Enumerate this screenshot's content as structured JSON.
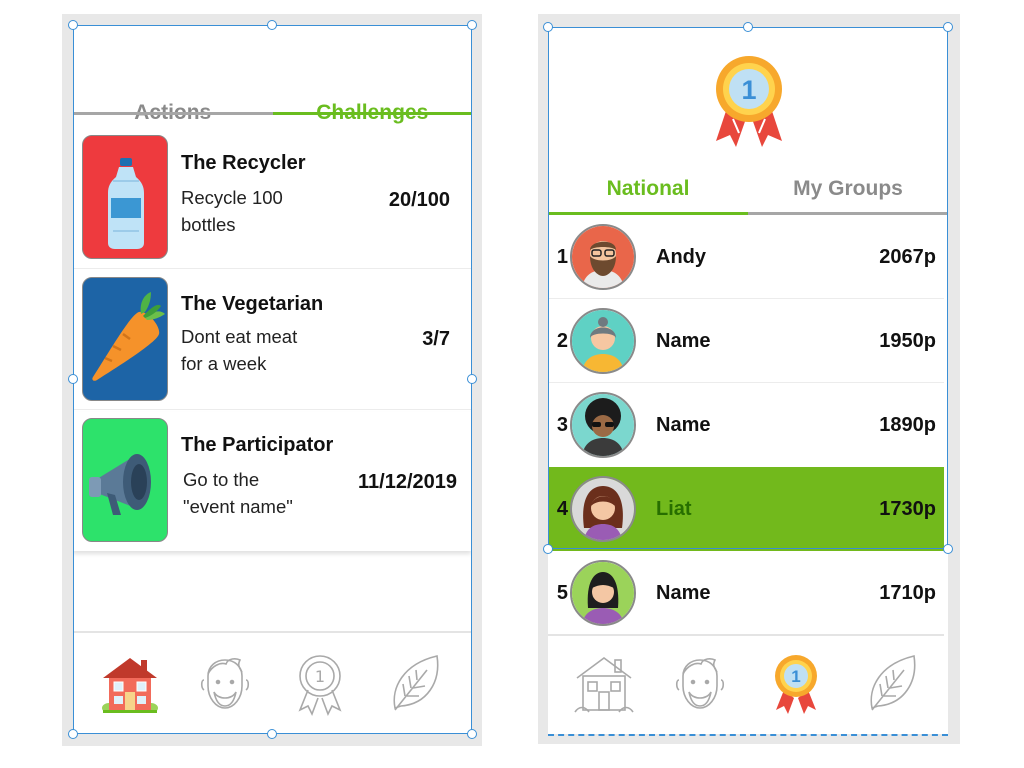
{
  "challenges_screen": {
    "tabs": [
      {
        "label": "Actions",
        "active": false
      },
      {
        "label": "Challenges",
        "active": true
      }
    ],
    "items": [
      {
        "title": "The Recycler",
        "desc_line1": "Recycle 100",
        "desc_line2": "bottles",
        "value": "20/100",
        "icon": "water-bottle-icon",
        "bg": "#ee3a3e"
      },
      {
        "title": "The Vegetarian",
        "desc_line1": "Dont eat meat",
        "desc_line2": "for a week",
        "value": "3/7",
        "icon": "carrot-icon",
        "bg": "#1d64a6"
      },
      {
        "title": "The Participator",
        "desc_line1": "Go to the",
        "desc_line2": "\"event name\"",
        "value": "11/12/2019",
        "icon": "megaphone-icon",
        "bg": "#2de26b"
      }
    ],
    "nav": [
      "home-icon",
      "profile-icon",
      "award-icon",
      "leaf-icon"
    ],
    "active_nav": "home-icon"
  },
  "leaderboard_screen": {
    "header_icon": "first-place-ribbon-icon",
    "badge_number": "1",
    "tabs": [
      {
        "label": "National",
        "active": true
      },
      {
        "label": "My Groups",
        "active": false
      }
    ],
    "rows": [
      {
        "rank": "1",
        "name": "Andy",
        "points": "2067p",
        "highlight": false
      },
      {
        "rank": "2",
        "name": "Name",
        "points": "1950p",
        "highlight": false
      },
      {
        "rank": "3",
        "name": "Name",
        "points": "1890p",
        "highlight": false
      },
      {
        "rank": "4",
        "name": "Liat",
        "points": "1730p",
        "highlight": true
      },
      {
        "rank": "5",
        "name": "Name",
        "points": "1710p",
        "highlight": false
      }
    ],
    "nav": [
      "home-icon",
      "profile-icon",
      "award-icon",
      "leaf-icon"
    ],
    "active_nav": "award-icon"
  },
  "colors": {
    "accent_green": "#6abd1f",
    "highlight_row": "#72b91c",
    "selection_blue": "#3a8fd6",
    "inactive_tab": "#8a8a8a"
  }
}
